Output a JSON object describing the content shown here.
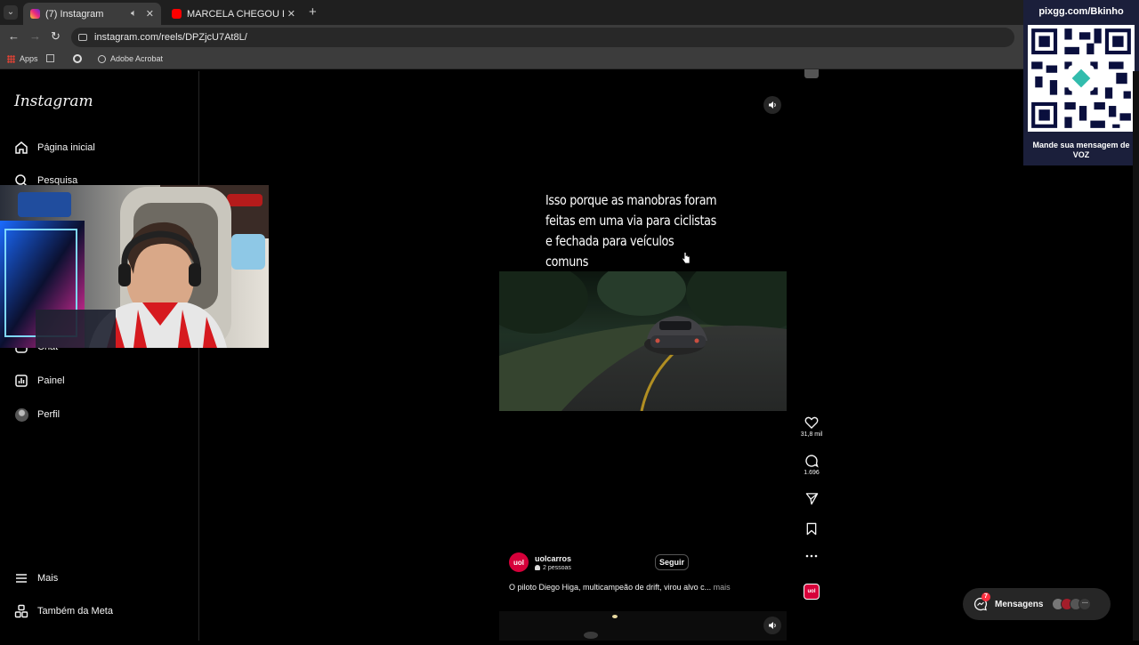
{
  "browser": {
    "tabs": [
      {
        "title": "(7) Instagram",
        "active": true,
        "favicon_color": "#e1306c"
      },
      {
        "title": "MARCELA CHEGOU PRA AGILIZ",
        "active": false,
        "favicon_color": "#ff0000"
      }
    ],
    "url": "instagram.com/reels/DPZjcU7At8L/",
    "bookmarks": [
      "Apps",
      "Adobe Acrobat"
    ]
  },
  "sidebar": {
    "logo": "Instagram",
    "items": [
      {
        "label": "Página inicial",
        "icon": "home-icon"
      },
      {
        "label": "Pesquisa",
        "icon": "search-icon"
      },
      {
        "label": "Chat",
        "icon": "chat-icon"
      },
      {
        "label": "Painel",
        "icon": "dashboard-icon"
      },
      {
        "label": "Perfil",
        "icon": "avatar-icon"
      }
    ],
    "bottom": [
      {
        "label": "Mais",
        "icon": "menu-icon"
      },
      {
        "label": "Também da Meta",
        "icon": "meta-icon"
      }
    ]
  },
  "reel": {
    "caption_text": "Isso porque as manobras foram feitas em uma via para ciclistas e fechada para veículos comuns",
    "likes": "31,8 mil",
    "comments": "1.696",
    "author": {
      "name": "uolcarros",
      "avatar_text": "uol",
      "sub": "2 pessoas"
    },
    "follow_label": "Seguir",
    "post_caption": "O piloto Diego Higa, multicampeão de drift, virou alvo c...",
    "more_label": "mais"
  },
  "messages": {
    "label": "Mensagens",
    "badge": "7"
  },
  "pix_overlay": {
    "url": "pixgg.com/Bkinho",
    "message": "Mande sua mensagem de VOZ"
  },
  "colors": {
    "instagram_red": "#d6003a",
    "pix_bg": "#1b1f3b",
    "chrome_bg": "#3c3c3c"
  }
}
